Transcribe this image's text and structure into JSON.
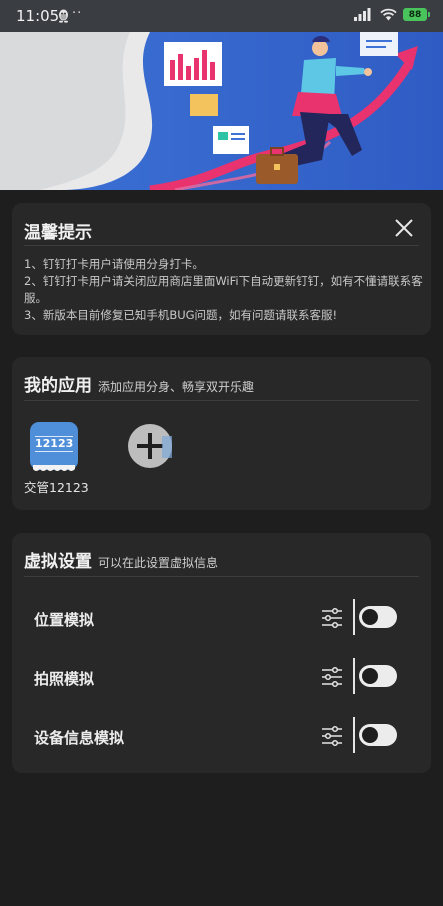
{
  "status_bar": {
    "time": "11:05",
    "dots": "··",
    "battery": "88"
  },
  "tips": {
    "title": "温馨提示",
    "items": [
      "1、钉钉打卡用户请使用分身打卡。",
      "2、钉钉打卡用户请关闭应用商店里面WiFi下自动更新钉钉，如有不懂请联系客服。",
      "3、新版本目前修复已知手机BUG问题，如有问题请联系客服!"
    ]
  },
  "apps": {
    "title": "我的应用",
    "subtitle": "添加应用分身、畅享双开乐趣",
    "items": [
      {
        "icon_text": "12123",
        "label": "交管12123"
      }
    ],
    "add_icon": "plus-icon"
  },
  "virtual": {
    "title": "虚拟设置",
    "subtitle": "可以在此设置虚拟信息",
    "rows": [
      {
        "label": "位置模拟",
        "enabled": false
      },
      {
        "label": "拍照模拟",
        "enabled": false
      },
      {
        "label": "设备信息模拟",
        "enabled": false
      }
    ]
  },
  "colors": {
    "background": "#1e1e1f",
    "card": "#282828",
    "status_bar": "#3a3d42",
    "battery": "#49c35b",
    "app_icon": "#4f8ed9",
    "banner_blue": "#3a6fd0",
    "banner_pink": "#e8336f"
  }
}
